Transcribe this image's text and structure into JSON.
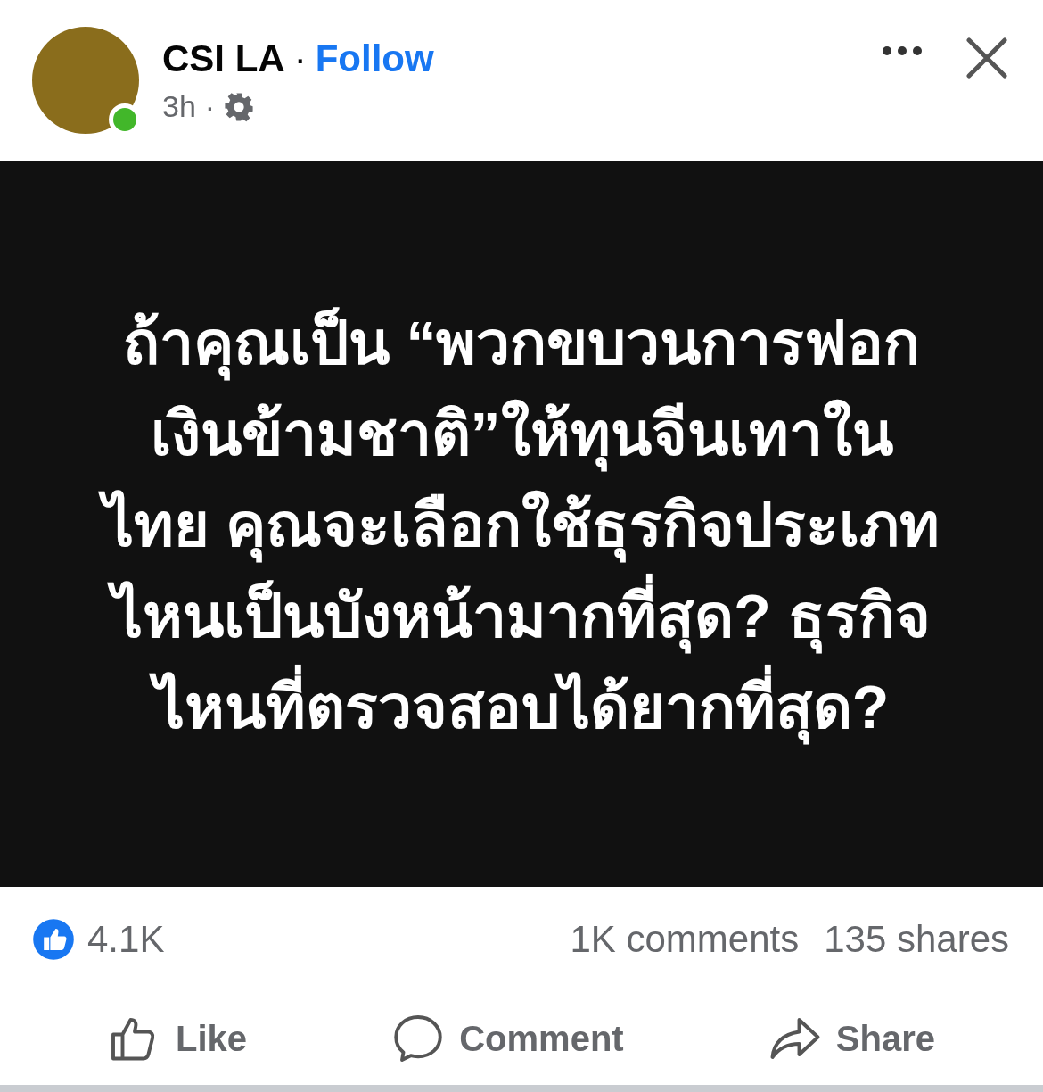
{
  "post": {
    "author": "CSI LA",
    "separator": "·",
    "follow": "Follow",
    "time": "3h",
    "time_separator": "·",
    "online": true
  },
  "text": "ถ้าคุณเป็น “พวกขบวนการฟอกเงินข้ามชาติ”ให้ทุนจีนเทาในไทย คุณจะเลือกใช้ธุรกิจประเภทไหนเป็นบังหน้ามากที่สุด? ธุรกิจไหนที่ตรวจสอบได้ยากที่สุด?",
  "stats": {
    "reactions": "4.1K",
    "comments": "1K comments",
    "shares": "135 shares"
  },
  "actions": [
    {
      "kind": "like",
      "label": "Like"
    },
    {
      "kind": "comment",
      "label": "Comment"
    },
    {
      "kind": "share",
      "label": "Share"
    }
  ]
}
